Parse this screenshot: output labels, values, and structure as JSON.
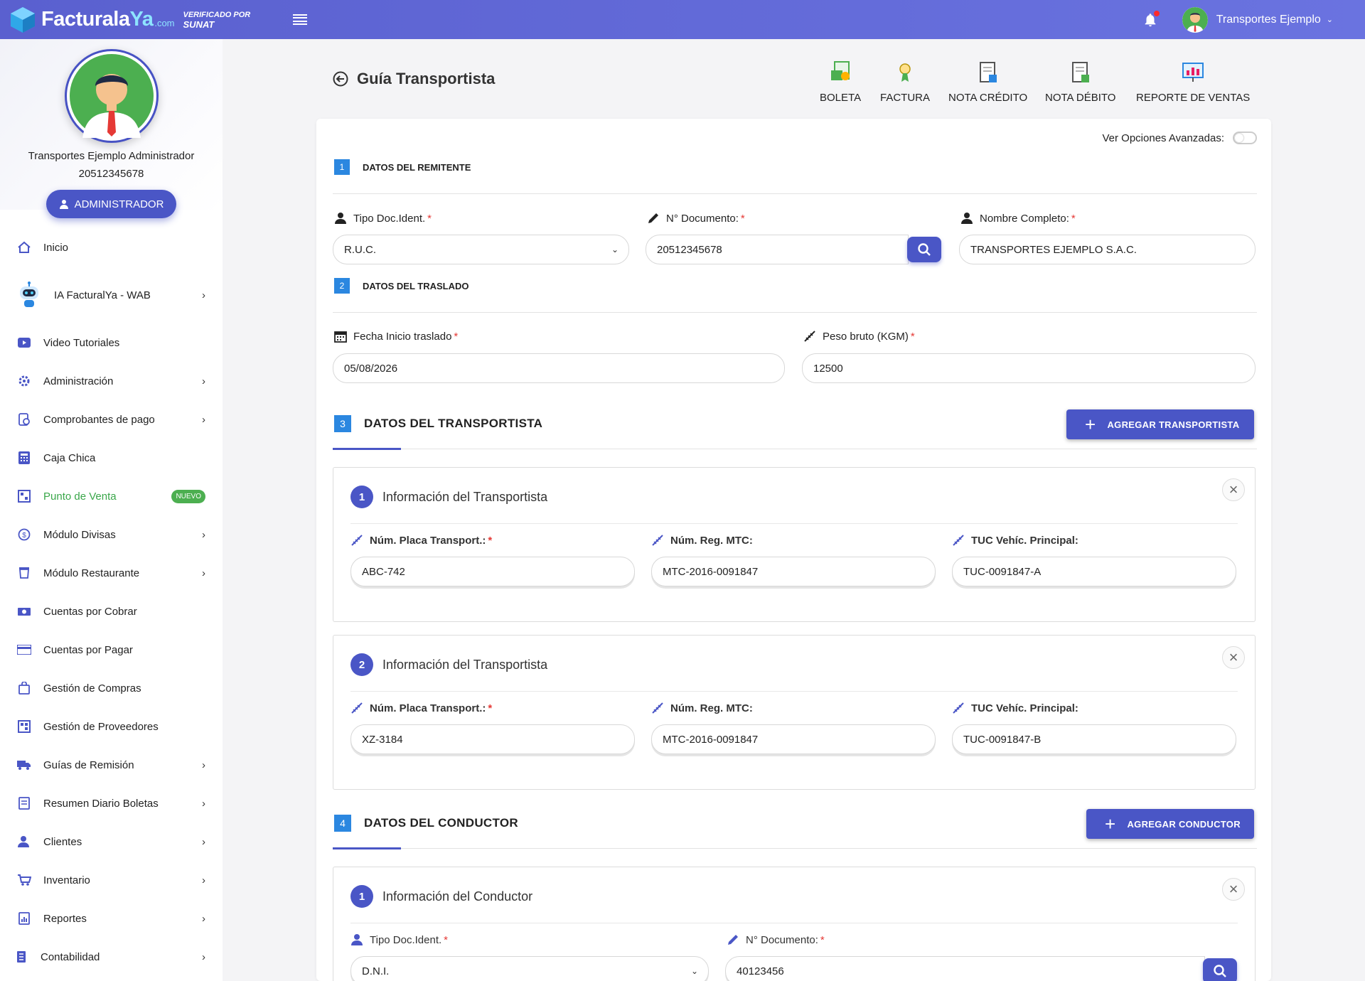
{
  "brand": {
    "name_a": "Facturala",
    "name_b": "Ya",
    "suffix": ".com",
    "verified_1": "VERIFICADO POR",
    "verified_2": "SUNAT"
  },
  "topbar": {
    "user_name": "Transportes Ejemplo"
  },
  "profile": {
    "name": "Transportes Ejemplo Administrador",
    "ruc": "20512345678",
    "role_button": "ADMINISTRADOR"
  },
  "sidebar": {
    "items": [
      {
        "label": "Inicio"
      },
      {
        "label": "IA FacturalYa - WAB"
      },
      {
        "label": "Video Tutoriales"
      },
      {
        "label": "Administración"
      },
      {
        "label": "Comprobantes de pago"
      },
      {
        "label": "Caja Chica"
      },
      {
        "label": "Punto de Venta",
        "badge": "NUEVO"
      },
      {
        "label": "Módulo Divisas"
      },
      {
        "label": "Módulo Restaurante"
      },
      {
        "label": "Cuentas por Cobrar"
      },
      {
        "label": "Cuentas por Pagar"
      },
      {
        "label": "Gestión de Compras"
      },
      {
        "label": "Gestión de Proveedores"
      },
      {
        "label": "Guías de Remisión"
      },
      {
        "label": "Resumen Diario Boletas"
      },
      {
        "label": "Clientes"
      },
      {
        "label": "Inventario"
      },
      {
        "label": "Reportes"
      },
      {
        "label": "Contabilidad"
      }
    ]
  },
  "page": {
    "title": "Guía Transportista"
  },
  "quick_actions": {
    "boleta": "BOLETA",
    "factura": "FACTURA",
    "nota_credito": "NOTA CRÉDITO",
    "nota_debito": "NOTA DÉBITO",
    "reporte": "REPORTE DE VENTAS"
  },
  "advanced": {
    "label": "Ver Opciones Avanzadas:"
  },
  "remitente": {
    "num": "1",
    "title": "DATOS DEL REMITENTE",
    "tipo_label": "Tipo Doc.Ident.",
    "tipo_value": "R.U.C.",
    "doc_label": "N° Documento:",
    "doc_value": "20512345678",
    "nombre_label": "Nombre Completo:",
    "nombre_value": "TRANSPORTES EJEMPLO S.A.C."
  },
  "traslado": {
    "num": "2",
    "title": "DATOS DEL TRASLADO",
    "fecha_label": "Fecha Inicio traslado",
    "fecha_value": "05/08/2026",
    "peso_label": "Peso bruto (KGM)",
    "peso_value": "12500"
  },
  "transportista": {
    "num": "3",
    "title": "DATOS DEL TRANSPORTISTA",
    "add_button": "AGREGAR TRANSPORTISTA",
    "cards": [
      {
        "num": "1",
        "title": "Información del Transportista",
        "placa_label": "Núm. Placa Transport.:",
        "placa": "ABC-742",
        "mtc_label": "Núm. Reg. MTC:",
        "mtc": "MTC-2016-0091847",
        "tuc_label": "TUC Vehíc. Principal:",
        "tuc": "TUC-0091847-A"
      },
      {
        "num": "2",
        "title": "Información del Transportista",
        "placa_label": "Núm. Placa Transport.:",
        "placa": "XZ-3184",
        "mtc_label": "Núm. Reg. MTC:",
        "mtc": "MTC-2016-0091847",
        "tuc_label": "TUC Vehíc. Principal:",
        "tuc": "TUC-0091847-B"
      }
    ]
  },
  "conductor": {
    "num": "4",
    "title": "DATOS DEL CONDUCTOR",
    "add_button": "AGREGAR CONDUCTOR",
    "card": {
      "num": "1",
      "title": "Información del Conductor",
      "tipo_label": "Tipo Doc.Ident.",
      "tipo_value": "D.N.I.",
      "doc_label": "N° Documento:",
      "doc_value": "40123456"
    }
  },
  "required_mark": "*",
  "colors": {
    "primary": "#4a56c6",
    "topbar": "#5a60cf",
    "section_num": "#2b87e0",
    "required": "#e53935",
    "green": "#4caf50"
  }
}
